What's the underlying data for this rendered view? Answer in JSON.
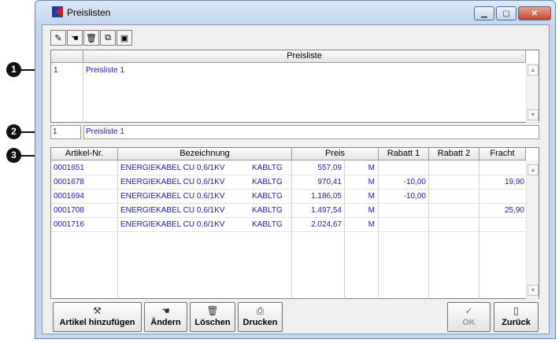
{
  "window": {
    "title": "Preislisten"
  },
  "titlebar_buttons": {
    "minimize": "▁",
    "maximize": "▢",
    "close": "✕"
  },
  "toolbar": [
    "pencil-icon",
    "hand-icon",
    "trash-icon",
    "copy-icon",
    "save-icon"
  ],
  "markers": [
    "1",
    "2",
    "3"
  ],
  "pricelist_table": {
    "header": "Preisliste",
    "rows": [
      {
        "nr": "1",
        "name": "Preisliste 1"
      }
    ]
  },
  "current": {
    "nr": "1",
    "name": "Preisliste 1"
  },
  "items_table": {
    "columns": [
      "Artikel-Nr.",
      "Bezeichnung",
      "Preis",
      "Rabatt 1",
      "Rabatt 2",
      "Fracht"
    ],
    "rows": [
      {
        "nr": "0001651",
        "desc": "ENERGIEKABEL CU  0,6/1KV",
        "code": "KABLTG",
        "price": "557,09",
        "unit": "M",
        "r1": "",
        "r2": "",
        "fracht": ""
      },
      {
        "nr": "0001678",
        "desc": "ENERGIEKABEL CU  0,6/1KV",
        "code": "KABLTG",
        "price": "970,41",
        "unit": "M",
        "r1": "-10,00",
        "r2": "",
        "fracht": "19,90"
      },
      {
        "nr": "0001694",
        "desc": "ENERGIEKABEL CU  0,6/1KV",
        "code": "KABLTG",
        "price": "1.186,05",
        "unit": "M",
        "r1": "-10,00",
        "r2": "",
        "fracht": ""
      },
      {
        "nr": "0001708",
        "desc": "ENERGIEKABEL CU  0,6/1KV",
        "code": "KABLTG",
        "price": "1.497,54",
        "unit": "M",
        "r1": "",
        "r2": "",
        "fracht": "25,90"
      },
      {
        "nr": "0001716",
        "desc": "ENERGIEKABEL CU  0,6/1KV",
        "code": "KABLTG",
        "price": "2.024,67",
        "unit": "M",
        "r1": "",
        "r2": "",
        "fracht": ""
      }
    ]
  },
  "buttons": {
    "add": "Artikel hinzufügen",
    "edit": "Ändern",
    "delete": "Löschen",
    "print": "Drucken",
    "ok": "OK",
    "back": "Zurück"
  }
}
